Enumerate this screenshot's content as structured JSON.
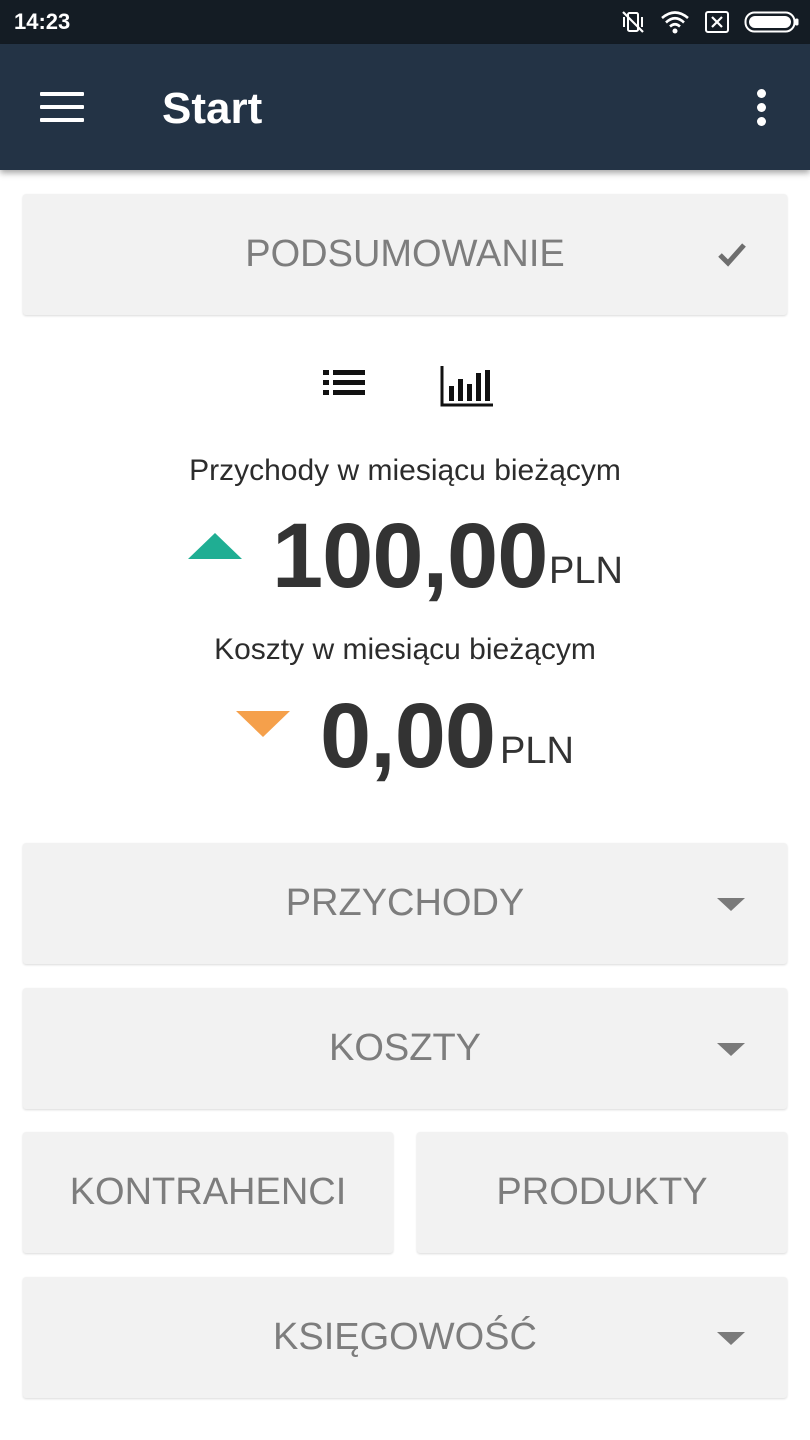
{
  "status_bar": {
    "time": "14:23",
    "icons": [
      "vibrate-off-icon",
      "wifi-icon",
      "sim-off-icon",
      "battery-icon"
    ]
  },
  "app_bar": {
    "title": "Start",
    "menu_icon": "hamburger-menu-icon",
    "more_icon": "more-vertical-icon"
  },
  "summary_panel": {
    "label": "PODSUMOWANIE",
    "icon": "check-icon"
  },
  "view_toggle": {
    "list_icon": "list-icon",
    "chart_icon": "bar-chart-icon"
  },
  "income": {
    "label": "Przychody w miesiącu bieżącym",
    "value": "100,00",
    "currency": "PLN",
    "trend": "up",
    "color": "#1fae93"
  },
  "costs": {
    "label": "Koszty w miesiącu bieżącym",
    "value": "0,00",
    "currency": "PLN",
    "trend": "down",
    "color": "#f5a04b"
  },
  "sections": {
    "income_label": "PRZYCHODY",
    "costs_label": "KOSZTY",
    "contractors_label": "KONTRAHENCI",
    "products_label": "PRODUKTY",
    "accounting_label": "KSIĘGOWOŚĆ"
  },
  "colors": {
    "app_bar": "#233345",
    "status_bar": "#141c24",
    "panel_bg": "#f2f2f2",
    "panel_text": "#7d7d7d"
  }
}
